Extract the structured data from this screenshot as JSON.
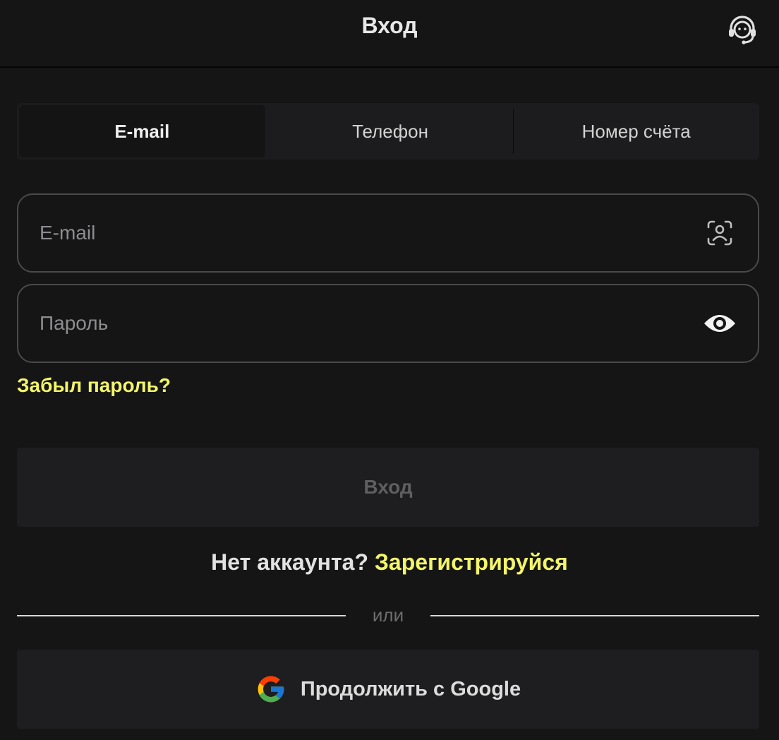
{
  "header": {
    "title": "Вход",
    "support_icon": "headset-support-icon"
  },
  "tabs": [
    {
      "label": "E-mail",
      "active": true
    },
    {
      "label": "Телефон",
      "active": false
    },
    {
      "label": "Номер счёта",
      "active": false
    }
  ],
  "form": {
    "email": {
      "value": "",
      "placeholder": "E-mail",
      "icon": "face-id-icon"
    },
    "password": {
      "value": "",
      "placeholder": "Пароль",
      "icon": "eye-icon"
    },
    "forgot_password": "Забыл пароль?",
    "login_button": "Вход"
  },
  "register": {
    "prompt": "Нет аккаунта?",
    "link": "Зарегистрируйся"
  },
  "divider": {
    "text": "или"
  },
  "google": {
    "label": "Продолжить с Google",
    "icon": "google-icon"
  },
  "colors": {
    "background": "#151516",
    "accent": "#f3f56a",
    "button_bg": "#1e1e21",
    "field_border": "#4a4a4c"
  }
}
